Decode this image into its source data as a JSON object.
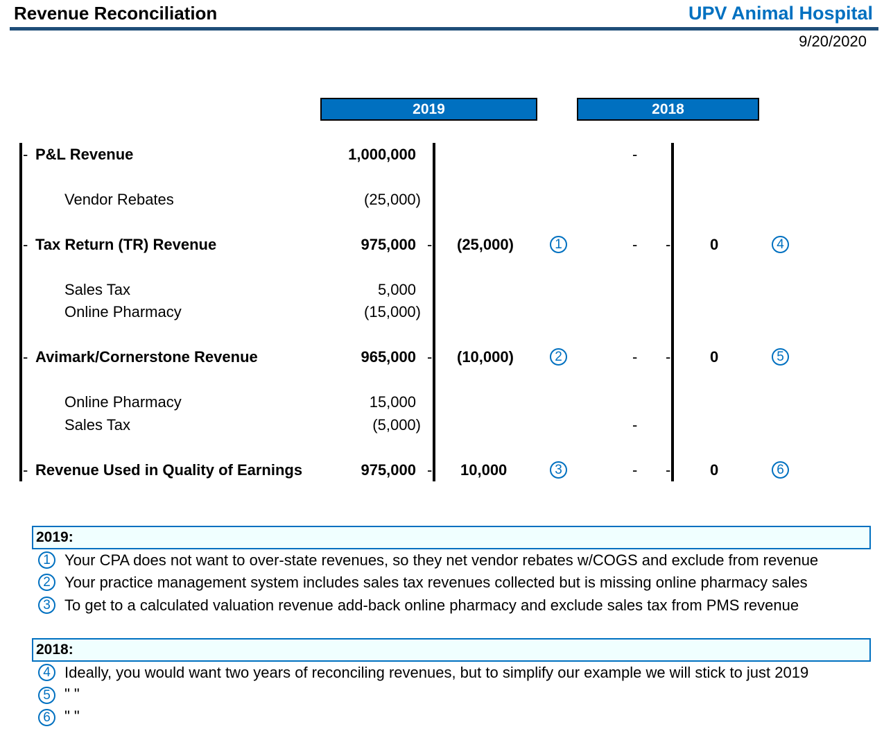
{
  "header": {
    "title": "Revenue Reconciliation",
    "company": "UPV Animal Hospital",
    "date": "9/20/2020"
  },
  "years": [
    "2019",
    "2018"
  ],
  "rows": {
    "pl_revenue": {
      "label": "P&L Revenue",
      "amount": "1,000,000",
      "y2018": "-"
    },
    "vendor_rebates": {
      "label": "Vendor Rebates",
      "amount": "(25,000)"
    },
    "tr_revenue": {
      "label": "Tax Return (TR) Revenue",
      "amount": "975,000",
      "diff2019": "(25,000)",
      "marker2019": "1",
      "y2018": "-",
      "diff2018": "0",
      "marker2018": "4"
    },
    "sales_tax_1": {
      "label": "Sales Tax",
      "amount": "5,000"
    },
    "online_pharmacy_1": {
      "label": "Online Pharmacy",
      "amount": "(15,000)"
    },
    "pms_revenue": {
      "label": "Avimark/Cornerstone Revenue",
      "amount": "965,000",
      "diff2019": "(10,000)",
      "marker2019": "2",
      "y2018": "-",
      "diff2018": "0",
      "marker2018": "5"
    },
    "online_pharmacy_2": {
      "label": "Online Pharmacy",
      "amount": "15,000"
    },
    "sales_tax_2": {
      "label": "Sales Tax",
      "amount": "(5,000)",
      "y2018": "-"
    },
    "qoe_revenue": {
      "label": "Revenue Used in Quality of Earnings",
      "amount": "975,000",
      "diff2019": "10,000",
      "marker2019": "3",
      "y2018": "-",
      "diff2018": "0",
      "marker2018": "6"
    }
  },
  "dash": "-",
  "notes_2019": {
    "header": "2019:",
    "items": [
      {
        "marker": "1",
        "text": "Your CPA does not want to over-state revenues, so they net vendor rebates w/COGS and exclude from revenue"
      },
      {
        "marker": "2",
        "text": "Your practice management system includes sales tax revenues collected but is missing online pharmacy sales"
      },
      {
        "marker": "3",
        "text": "To get to a calculated valuation revenue add-back online pharmacy and exclude sales tax from PMS revenue"
      }
    ]
  },
  "notes_2018": {
    "header": "2018:",
    "items": [
      {
        "marker": "4",
        "text": "Ideally, you would want two years of reconciling revenues, but to simplify our example we will stick to just 2019"
      },
      {
        "marker": "5",
        "text": "\"   \""
      },
      {
        "marker": "6",
        "text": "\"   \""
      }
    ]
  },
  "colors": {
    "accent": "#0070c0",
    "rule": "#1f4e79",
    "note_fill": "#f0ffff"
  }
}
